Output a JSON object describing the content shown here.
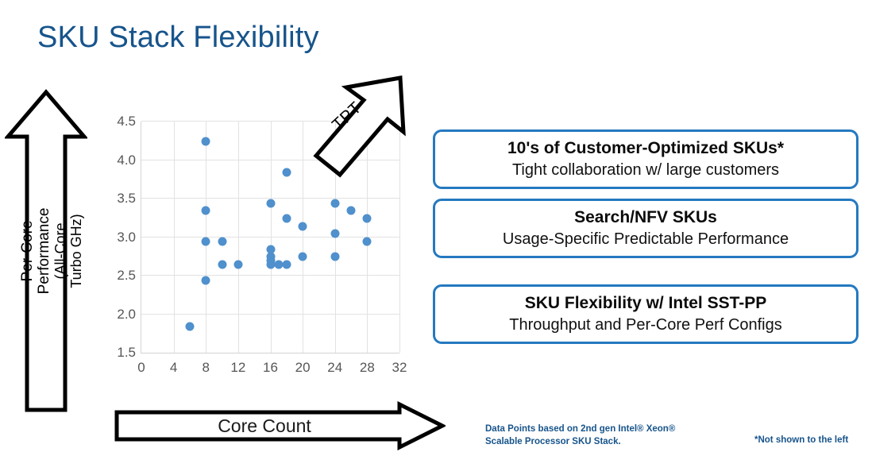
{
  "title": "SKU Stack Flexibility",
  "colors": {
    "title": "#17548B",
    "point": "#4F90CD",
    "callout_border": "#2579C0",
    "footnote": "#17548B"
  },
  "y_axis_arrow": {
    "line1": "Per-Core Performance",
    "line2": "(All-Core Turbo GHz)",
    "icon": "up-arrow-icon"
  },
  "x_axis_arrow": {
    "label": "Core Count",
    "icon": "right-arrow-icon"
  },
  "tpt_arrow": {
    "label": "TPT",
    "icon": "diagonal-up-right-arrow-icon"
  },
  "callouts": [
    {
      "heading": "10's of Customer-Optimized SKUs*",
      "subtext": "Tight collaboration w/ large customers"
    },
    {
      "heading": "Search/NFV SKUs",
      "subtext": "Usage-Specific Predictable Performance"
    },
    {
      "heading": "SKU Flexibility w/ Intel SST-PP",
      "subtext": "Throughput and Per-Core Perf Configs"
    }
  ],
  "footnotes": {
    "source": "Data Points based on 2nd gen Intel® Xeon®\nScalable Processor SKU Stack.",
    "asterisk": "*Not shown to the left"
  },
  "chart_data": {
    "type": "scatter",
    "title": "",
    "xlabel": "Core Count",
    "ylabel": "Per-Core Performance (All-Core Turbo GHz)",
    "xlim": [
      0,
      32
    ],
    "ylim": [
      1.5,
      4.5
    ],
    "xticks": [
      0,
      4,
      8,
      12,
      16,
      20,
      24,
      28,
      32
    ],
    "yticks": [
      1.5,
      2.0,
      2.5,
      3.0,
      3.5,
      4.0,
      4.5
    ],
    "grid": true,
    "legend": "none",
    "series": [
      {
        "name": "2nd gen Intel Xeon Scalable SKUs",
        "color": "#4F90CD",
        "points": [
          [
            6,
            1.9
          ],
          [
            8,
            4.3
          ],
          [
            8,
            3.4
          ],
          [
            8,
            3.0
          ],
          [
            8,
            2.5
          ],
          [
            10,
            3.0
          ],
          [
            10,
            2.7
          ],
          [
            12,
            2.7
          ],
          [
            16,
            3.5
          ],
          [
            16,
            2.9
          ],
          [
            16,
            2.8
          ],
          [
            16,
            2.75
          ],
          [
            16,
            2.7
          ],
          [
            17,
            2.7
          ],
          [
            18,
            3.9
          ],
          [
            18,
            3.3
          ],
          [
            18,
            2.7
          ],
          [
            20,
            3.2
          ],
          [
            20,
            2.8
          ],
          [
            24,
            3.5
          ],
          [
            24,
            3.1
          ],
          [
            24,
            2.8
          ],
          [
            26,
            3.4
          ],
          [
            28,
            3.3
          ],
          [
            28,
            3.0
          ]
        ]
      }
    ]
  }
}
